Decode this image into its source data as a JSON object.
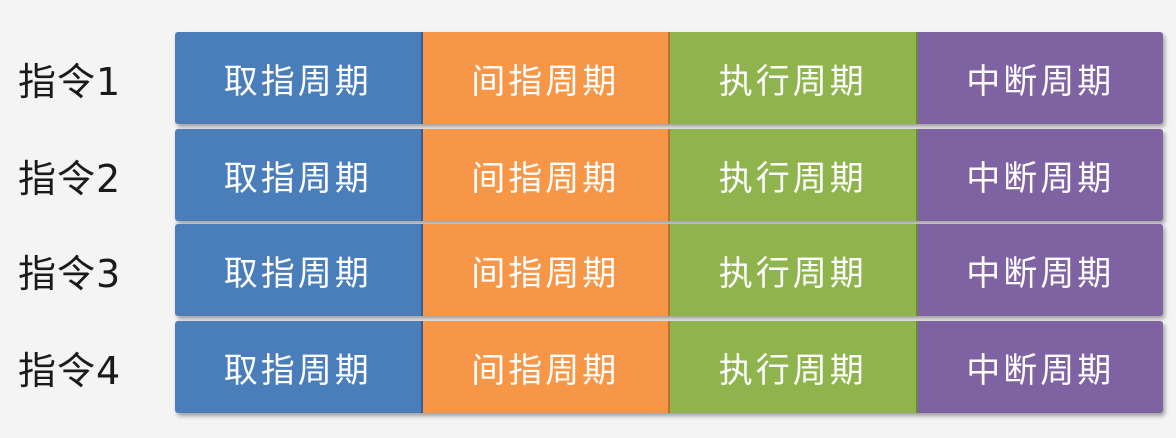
{
  "colors": {
    "fetch": "#4a7ebb",
    "indirect": "#f79646",
    "execute": "#8fb44e",
    "interrupt": "#7f62a1"
  },
  "rows": [
    {
      "label": "指令1",
      "cells": [
        "取指周期",
        "间指周期",
        "执行周期",
        "中断周期"
      ]
    },
    {
      "label": "指令2",
      "cells": [
        "取指周期",
        "间指周期",
        "执行周期",
        "中断周期"
      ]
    },
    {
      "label": "指令3",
      "cells": [
        "取指周期",
        "间指周期",
        "执行周期",
        "中断周期"
      ]
    },
    {
      "label": "指令4",
      "cells": [
        "取指周期",
        "间指周期",
        "执行周期",
        "中断周期"
      ]
    }
  ]
}
